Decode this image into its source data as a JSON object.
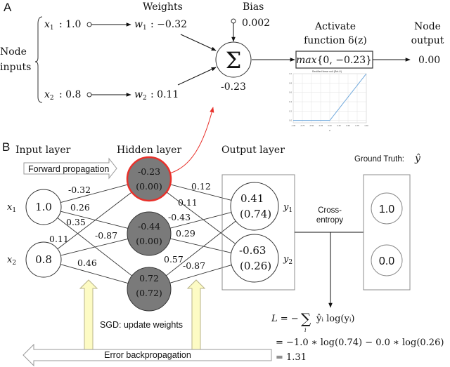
{
  "panel_a": {
    "label": "A",
    "node_inputs_label": [
      "Node",
      "inputs"
    ],
    "weights_title": "Weights",
    "inputs": [
      {
        "name": "x1",
        "sub": "1",
        "value": "1.0"
      },
      {
        "name": "x2",
        "sub": "2",
        "value": "0.8"
      }
    ],
    "weights": [
      {
        "name": "w1",
        "sub": "1",
        "value": "−0.32"
      },
      {
        "name": "w2",
        "sub": "2",
        "value": "0.11"
      }
    ],
    "bias_title": "Bias",
    "bias_value": "0.002",
    "sum_symbol": "Σ",
    "sum_value": "-0.23",
    "activation_title": [
      "Activate",
      "function δ(z)"
    ],
    "activation_expr_fn": "max",
    "activation_expr_args": "{0, −0.23}",
    "output_title": [
      "Node",
      "output"
    ],
    "output_value": "0.00",
    "relu_plot": {
      "title": "Rectified linear unit (ReLU)",
      "x_ticks": [
        "-1.00",
        "-0.75",
        "-0.50",
        "-0.25",
        "0.00",
        "0.25",
        "0.50",
        "0.75",
        "1.00"
      ],
      "y_ticks": [
        "0.0",
        "0.2",
        "0.4",
        "0.6",
        "0.8",
        "1.0"
      ],
      "xlabel": "z",
      "line_color": "#6fa8dc"
    }
  },
  "panel_b": {
    "label": "B",
    "input_layer_title": "Input layer",
    "hidden_layer_title": "Hidden layer",
    "output_layer_title": "Output layer",
    "forward_label": "Forward propagation",
    "backward_label": "Error backpropagation",
    "sgd_label": "SGD: update weights",
    "ground_truth_label": "Ground Truth:",
    "ground_truth_symbol": "ŷ",
    "cross_entropy_label": [
      "Cross-",
      "entropy"
    ],
    "input_nodes": [
      {
        "label": "x",
        "sub": "1",
        "value": "1.0"
      },
      {
        "label": "x",
        "sub": "2",
        "value": "0.8"
      }
    ],
    "hidden_nodes": [
      {
        "pre": "-0.23",
        "post": "(0.00)",
        "highlight": true
      },
      {
        "pre": "-0.44",
        "post": "(0.00)",
        "highlight": false
      },
      {
        "pre": "0.72",
        "post": "(0.72)",
        "highlight": false
      }
    ],
    "output_nodes": [
      {
        "label": "y",
        "sub": "1",
        "pre": "0.41",
        "post": "(0.74)"
      },
      {
        "label": "y",
        "sub": "2",
        "pre": "-0.63",
        "post": "(0.26)"
      }
    ],
    "ground_truth_values": [
      "1.0",
      "0.0"
    ],
    "weights_input_hidden": [
      "-0.32",
      "0.26",
      "0.35",
      "0.11",
      "-0.87",
      "0.46"
    ],
    "weights_hidden_output": [
      "0.12",
      "0.11",
      "-0.43",
      "0.29",
      "0.57",
      "-0.87"
    ],
    "loss": {
      "line1_lhs": "L = −",
      "line1_sum": "∑",
      "line1_sub": "i",
      "line1_rhs": "ŷᵢ log(yᵢ)",
      "line2": "= −1.0 ∗ log(0.74) − 0.0 ∗ log(0.26)",
      "line3": "= 1.31"
    }
  },
  "colors": {
    "highlight": "#e8302a",
    "hidden_fill": "#7a7a7a",
    "arrow_fill": "#fdfbc4",
    "arrow_stroke": "#b8b38a",
    "box_stroke": "#8c8c8c"
  }
}
